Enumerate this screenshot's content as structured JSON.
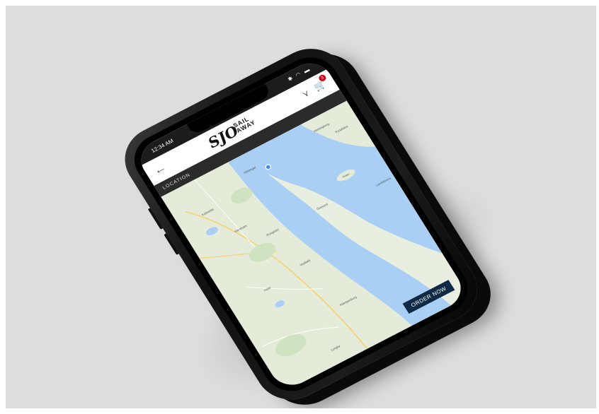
{
  "status_bar": {
    "time": "12:34 AM",
    "icons": "✱ ◠ ▬"
  },
  "header": {
    "back_icon": "←",
    "logo_mark": "SJO",
    "logo_line1": "SAIL",
    "logo_line2": "AWAY",
    "filter_icon": "⋎",
    "cart_icon": "🛒",
    "cart_badge": "3"
  },
  "section": {
    "title": "LOCATION"
  },
  "map": {
    "labels": [
      "Helsingborg",
      "Helsingør",
      "Kokkedal",
      "Hørsholm",
      "Rungsted",
      "Vedbæk",
      "Holte",
      "Hven",
      "Öresund",
      "Rydebäck",
      "Landskrona",
      "Klampenborg",
      "Lyngby"
    ],
    "water_color": "#a9cff5",
    "land_color": "#e8eee0"
  },
  "cta": {
    "label": "ORDER NOW"
  }
}
